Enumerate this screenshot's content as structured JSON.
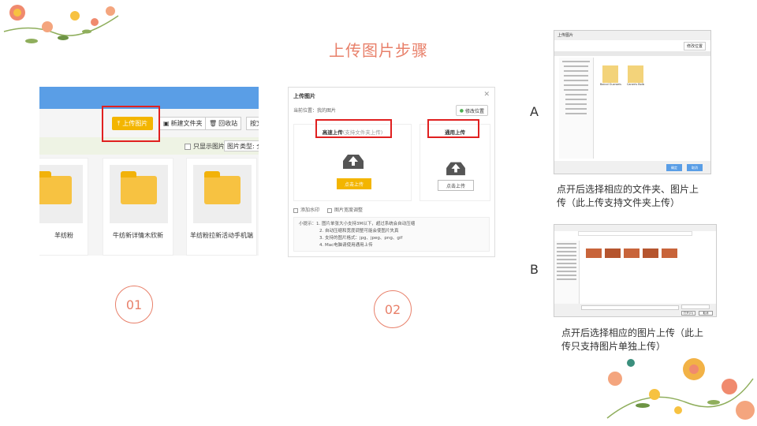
{
  "title": "上传图片步骤",
  "step1": {
    "upload_button": "上传图片",
    "new_folder_button": "新建文件夹",
    "recycle_button": "回收站",
    "sort_button": "按文",
    "only_images_label": "只显示图片",
    "image_type_label": "图片类型:",
    "image_type_value": "全",
    "cards": [
      {
        "caption": "羊纺粉"
      },
      {
        "caption": "牛纺新详情木欣新"
      },
      {
        "caption": "羊纺粉拉新活动手机端"
      }
    ]
  },
  "step2": {
    "dialog_title": "上传图片",
    "location_label": "当前位置：我的图片",
    "change_location": "修改位置",
    "fast_upload_title": "高速上传",
    "fast_upload_sub": "(支持文件夹上传)",
    "normal_upload_title": "通用上传",
    "click_upload_primary": "点击上传",
    "click_upload_secondary": "点击上传",
    "watermark_option": "添加水印",
    "resize_option": "图片宽度调整",
    "tips": [
      "小提示：1. 图片单张大小支持3M以下，超过系统会自动压缩",
      "2. 自动压缩和宽度调整可能会使图片失真",
      "3. 支持的图片格式：jpg、jpeg、png、gif",
      "4. Mac电脑请使用通用上传"
    ]
  },
  "step_numbers": [
    "01",
    "02"
  ],
  "option_a": {
    "letter": "A",
    "dialog_title": "上传图片",
    "change_location": "修改位置",
    "folders": [
      "Baicol Ouzroeis",
      "Caneris Bolb"
    ],
    "ok": "确定",
    "cancel": "取消",
    "caption": "点开后选择相应的文件夹、图片上传（此上传支持文件夹上传）"
  },
  "option_b": {
    "letter": "B",
    "open_btn": "打开(O)",
    "cancel_btn": "取消",
    "caption": "点开后选择相应的图片上传（此上传只支持图片单独上传）"
  },
  "colors": {
    "accent": "#e8806a",
    "upload_yellow": "#f3b500",
    "highlight_red": "#e02020",
    "topbar_blue": "#5a9ee6"
  }
}
